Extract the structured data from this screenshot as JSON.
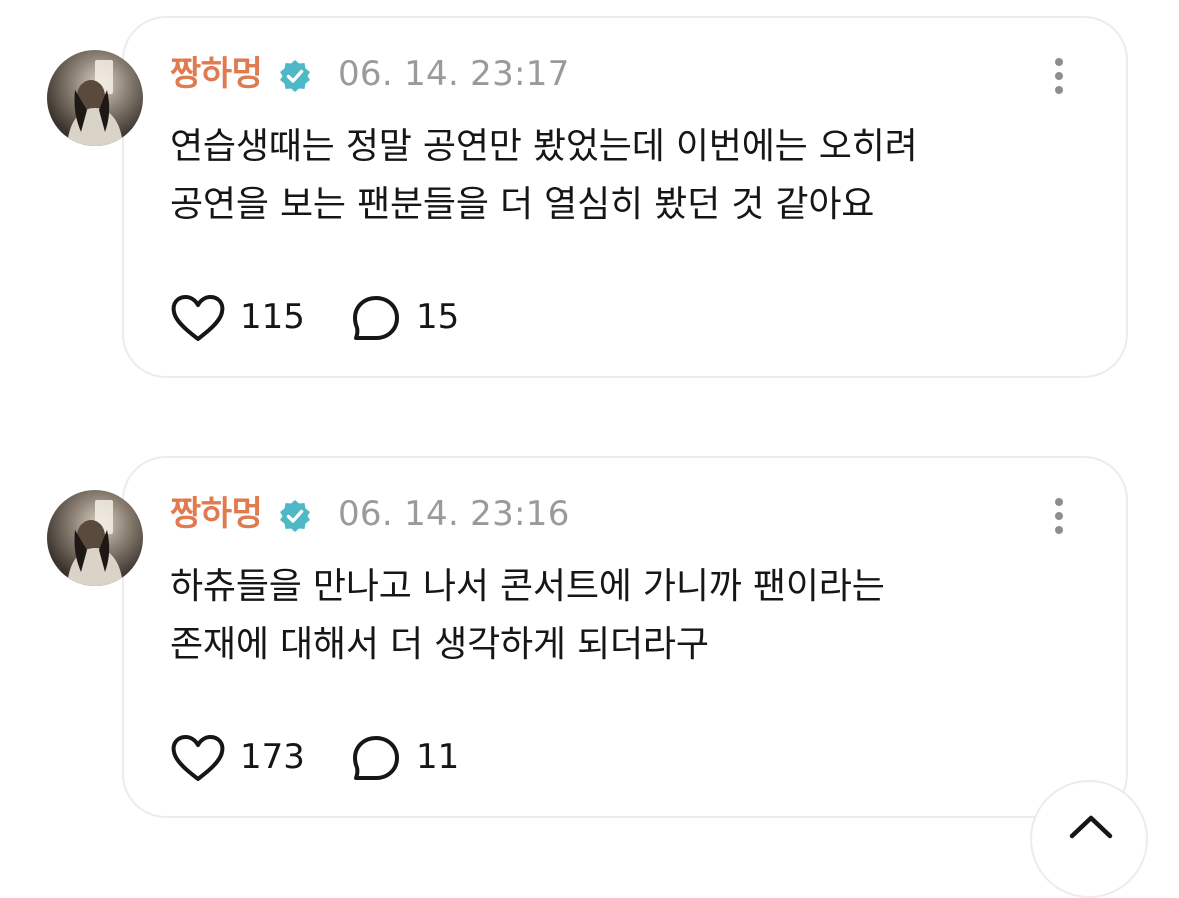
{
  "posts": [
    {
      "author": "짱하멍",
      "timestamp": "06. 14. 23:17",
      "text_lines": [
        "연습생때는 정말 공연만 봤었는데 이번에는 오히려",
        "공연을 보는 팬분들을 더 열심히 봤던 것 같아요"
      ],
      "likes": "115",
      "comments": "15"
    },
    {
      "author": "짱하멍",
      "timestamp": "06. 14. 23:16",
      "text_lines": [
        "하츄들을 만나고 나서 콘서트에 가니까 팬이라는",
        "존재에 대해서 더 생각하게 되더라구"
      ],
      "likes": "173",
      "comments": "11"
    }
  ],
  "icons": {
    "verified": "verified-badge-icon",
    "like": "heart-outline-icon",
    "comment": "speech-bubble-icon",
    "more": "more-vertical-icon",
    "scroll_top": "chevron-up-icon"
  },
  "colors": {
    "author": "#e07a4f",
    "verified": "#4fb8c6",
    "timestamp": "#9a9a9a",
    "text": "#161616",
    "card_border": "#ececec"
  }
}
